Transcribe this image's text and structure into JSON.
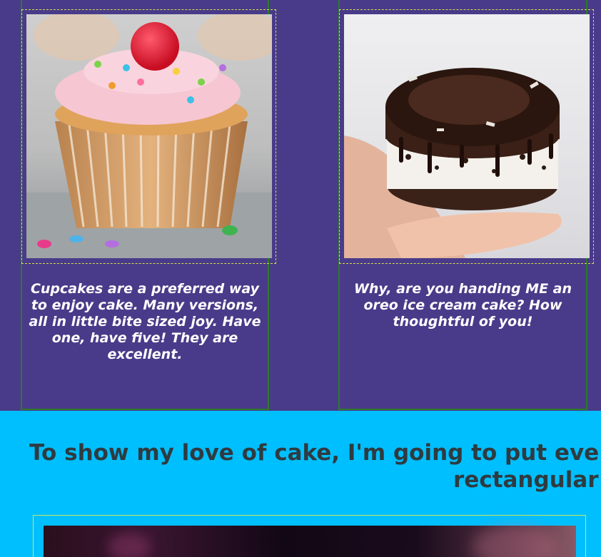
{
  "cards": [
    {
      "image_name": "cupcake-photo",
      "caption": "Cupcakes are a preferred way to enjoy cake. Many versions, all in little bite sized joy. Have one, have five! They are excellent."
    },
    {
      "image_name": "oreo-ice-cream-cake-photo",
      "caption": "Why, are you handing ME an oreo ice cream cake? How thoughtful of you!"
    }
  ],
  "section": {
    "heading_line1": "To show my love of cake, I'm going to put eve",
    "heading_line2": "rectangular!"
  },
  "colors": {
    "top_background": "#493b89",
    "bottom_background": "#00bfff",
    "card_border": "#2d7a2a",
    "frame_border": "#d4e04a",
    "heading_text": "#2f3b40",
    "caption_text": "#ffffff"
  }
}
